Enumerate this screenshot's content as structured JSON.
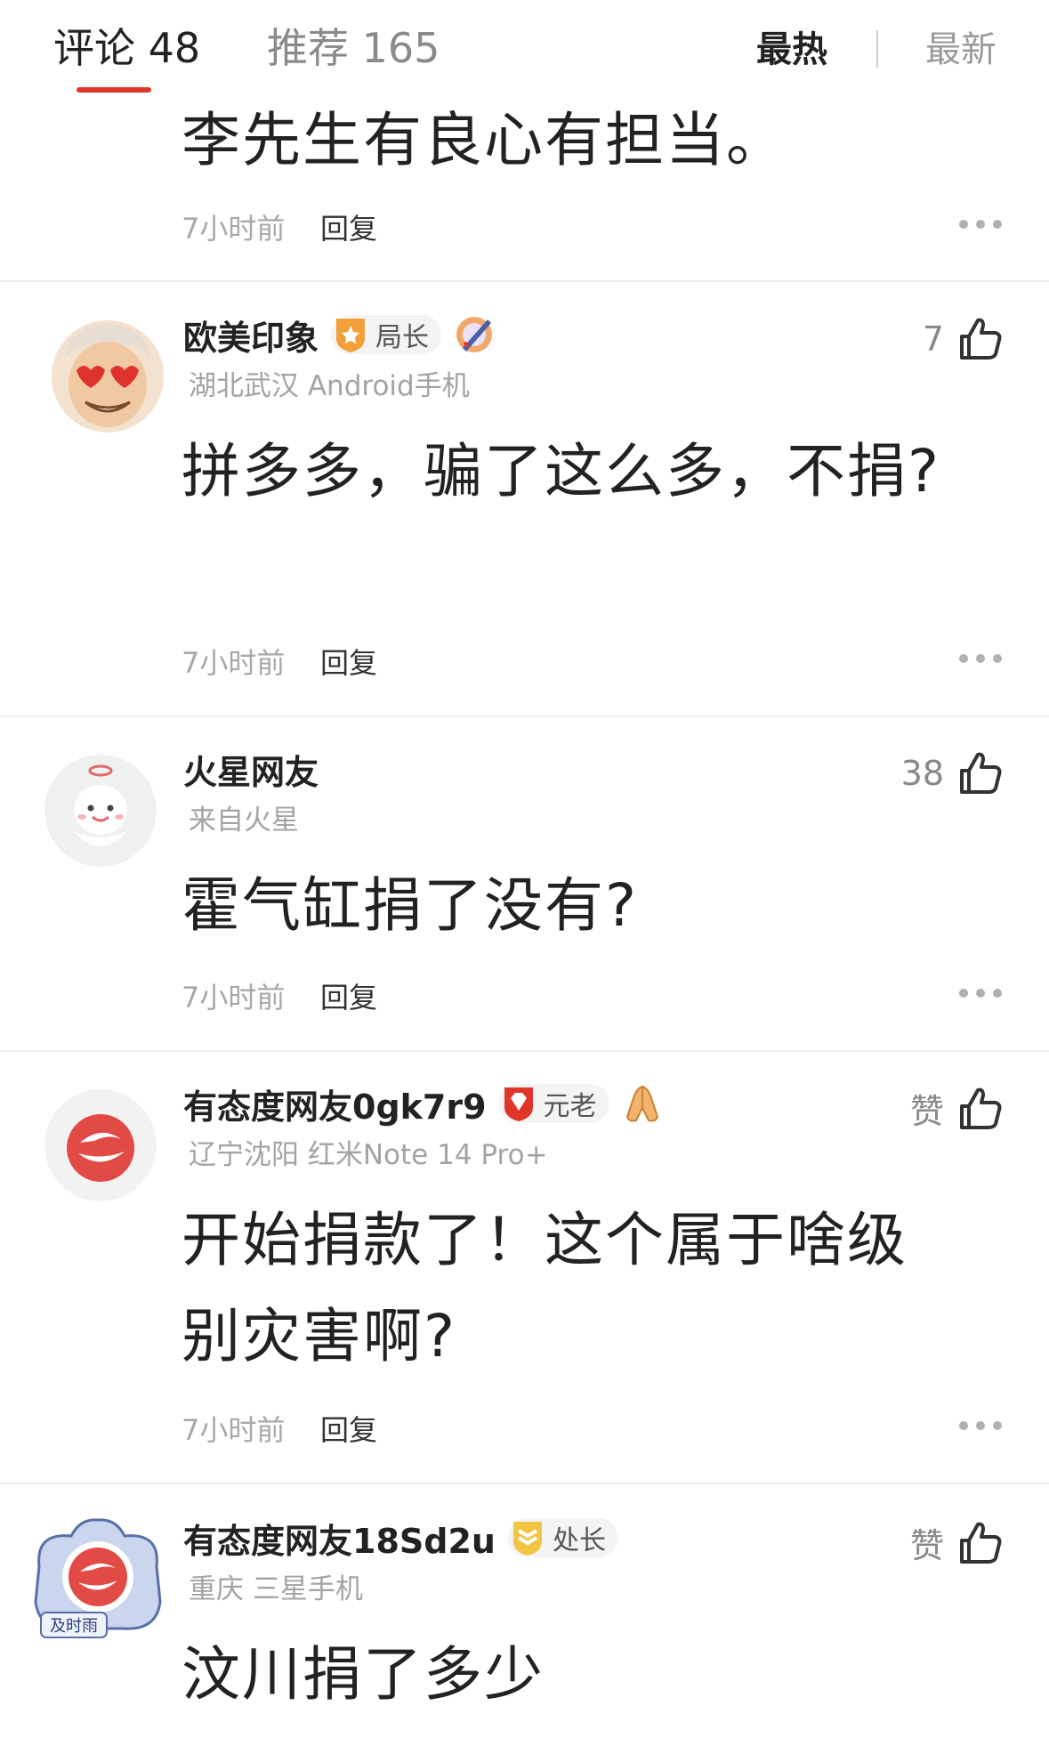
{
  "header": {
    "tab_comments": "评论 48",
    "tab_recommend": "推荐 165",
    "sort_hot": "最热",
    "sort_new": "最新",
    "accent_color": "#e0352b"
  },
  "comments": [
    {
      "content": "李先生有良心有担当。",
      "time": "7小时前",
      "reply_label": "回复"
    },
    {
      "username": "欧美印象",
      "badge_label": "局长",
      "badge_icon": "shield-star-icon",
      "medal_icon": "pen-medal-icon",
      "avatar": "heart-eyes-avatar",
      "meta": "湖北武汉 Android手机",
      "content": "拼多多，骗了这么多，不捐?",
      "time": "7小时前",
      "reply_label": "回复",
      "likes": "7"
    },
    {
      "username": "火星网友",
      "avatar": "mars-user-avatar",
      "meta": "来自火星",
      "content": "霍气缸捐了没有?",
      "time": "7小时前",
      "reply_label": "回复",
      "likes": "38"
    },
    {
      "username": "有态度网友0gk7r9",
      "badge_label": "元老",
      "badge_icon": "ruby-badge-icon",
      "medal_icon": "praying-hands-icon",
      "avatar": "netease-logo-avatar",
      "meta": "辽宁沈阳 红米Note 14 Pro+",
      "content": "开始捐款了！这个属于啥级别灾害啊?",
      "time": "7小时前",
      "reply_label": "回复",
      "likes": "赞"
    },
    {
      "username": "有态度网友18Sd2u",
      "badge_label": "处长",
      "badge_icon": "chevron-rank-icon",
      "avatar": "timely-rain-avatar",
      "avatar_caption": "及时雨",
      "meta": "重庆 三星手机",
      "content": "汶川捐了多少",
      "likes": "赞"
    }
  ]
}
